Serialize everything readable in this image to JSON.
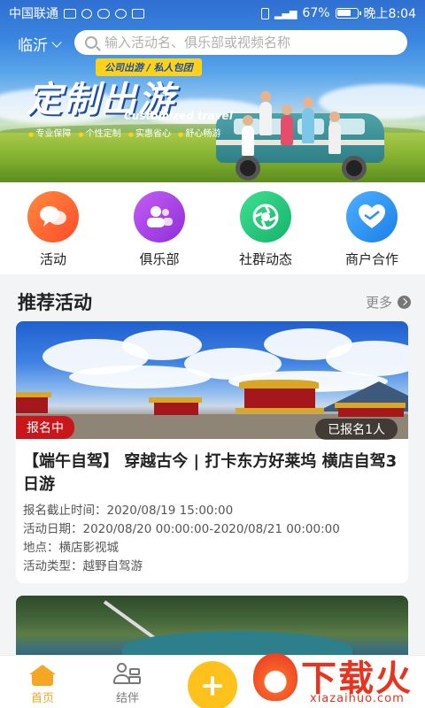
{
  "status_bar": {
    "carrier": "中国联通",
    "battery": "67%",
    "time": "晚上8:04"
  },
  "header": {
    "city": "临沂",
    "search_placeholder": "输入活动名、俱乐部或视频名称"
  },
  "banner": {
    "badge": "公司出游 / 私人包团",
    "title": "定制出游",
    "subtitle_en": "Customized travel",
    "tags": [
      "专业保障",
      "个性定制",
      "实惠省心",
      "舒心畅游"
    ]
  },
  "categories": [
    {
      "label": "活动",
      "icon": "chat-bubbles-icon",
      "color": "#ff5a2e"
    },
    {
      "label": "俱乐部",
      "icon": "group-icon",
      "color": "#a53be6"
    },
    {
      "label": "社群动态",
      "icon": "aperture-icon",
      "color": "#1fc67a"
    },
    {
      "label": "商户合作",
      "icon": "heart-handshake-icon",
      "color": "#2a8ff0"
    }
  ],
  "section": {
    "title": "推荐活动",
    "more": "更多"
  },
  "card": {
    "status": "报名中",
    "signed": "已报名1人",
    "title": "【端午自驾】 穿越古今 | 打卡东方好莱坞 横店自驾3日游",
    "deadline": "报名截止时间：2020/08/19 15:00:00",
    "dates": "活动日期：2020/08/20 00:00:00-2020/08/21 00:00:00",
    "location": "地点：横店影视城",
    "type": "活动类型：越野自驾游"
  },
  "nav": {
    "home": "首页",
    "buddy": "结伴"
  },
  "watermark": {
    "text": "下载火",
    "sub": "xiazaihuo.com"
  },
  "colors": {
    "accent": "#f5a623",
    "status_red": "#c8161d",
    "add_button": "#ffc21c"
  }
}
